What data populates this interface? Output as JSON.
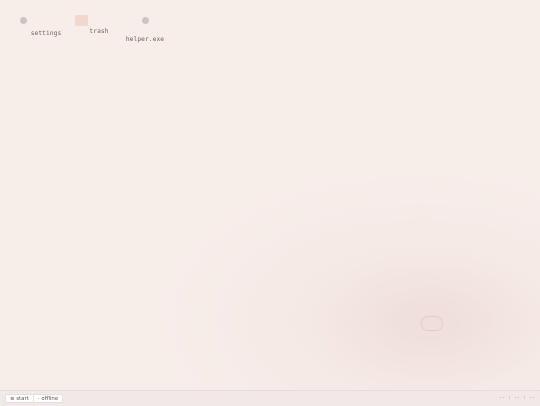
{
  "desktop": {
    "icons": [
      {
        "label": "settings",
        "icon": "settings-dot-icon"
      },
      {
        "label": "trash",
        "icon": "trash-icon"
      },
      {
        "label": "helper.exe",
        "icon": "app-dot-icon"
      }
    ]
  },
  "taskbar": {
    "start_label": "≡ start",
    "status_label": "· offline",
    "tray_text": "-- : -- : --"
  },
  "colors": {
    "background": "#f7ede9",
    "trash_accent": "#f2d8cc",
    "taskbar": "#f1e9e7"
  }
}
